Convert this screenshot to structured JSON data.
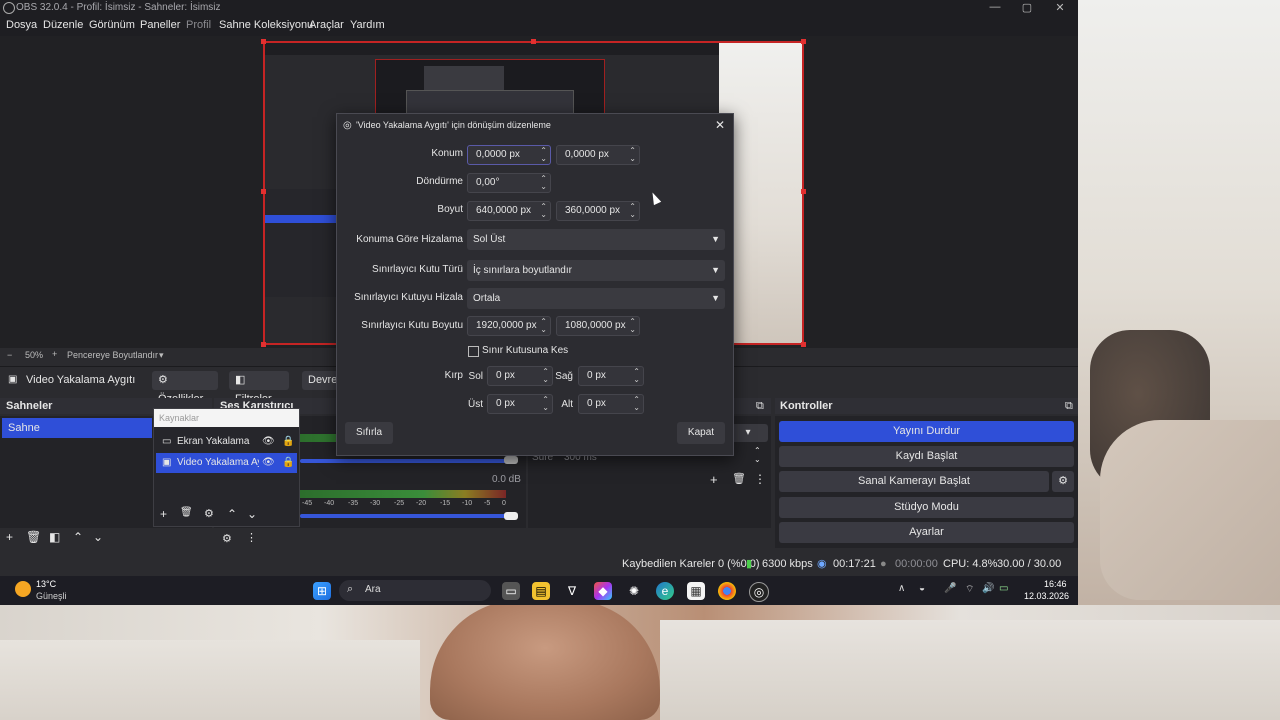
{
  "window": {
    "title": "OBS 32.0.4 - Profil: İsimsiz - Sahneler: İsimsiz",
    "controls": [
      "—",
      "▢",
      "✕"
    ]
  },
  "menu": [
    "Dosya",
    "Düzenle",
    "Görünüm",
    "Paneller",
    "Profil",
    "Sahne Koleksiyonu",
    "Araçlar",
    "Yardım"
  ],
  "zoom": {
    "minus": "−",
    "level": "50%",
    "plus": "+",
    "fit": "Pencereye Boyutlandır"
  },
  "source_bar": {
    "source_name": "Video Yakalama Aygıtı",
    "properties": "Özellikler",
    "filters": "Filtreler",
    "deactivate": "Devre"
  },
  "scenes": {
    "title": "Sahneler",
    "items": [
      "Sahne"
    ]
  },
  "sources_popup": {
    "title": "Kaynaklar",
    "items": [
      "Ekran Yakalama",
      "Video Yakalama Ay"
    ]
  },
  "mixer": {
    "title": "Ses Karıştırıcı",
    "level": "0.0 dB",
    "ticks": [
      "-45",
      "-40",
      "-35",
      "-30",
      "-25",
      "-20",
      "-15",
      "-10",
      "-5",
      "0"
    ]
  },
  "transition": {
    "duration_label": "Süre",
    "duration_value": "300 ms"
  },
  "controls": {
    "title": "Kontroller",
    "buttons": [
      "Yayını Durdur",
      "Kaydı Başlat",
      "Sanal Kamerayı Başlat",
      "Stüdyo Modu",
      "Ayarlar"
    ]
  },
  "status": {
    "dropped": "Kaybedilen Kareler 0 (%0.0)",
    "bitrate": "6300 kbps",
    "stream_time": "00:17:21",
    "rec_time": "00:00:00",
    "cpu": "CPU: 4.8%",
    "fps": "30.00 / 30.00 FPS"
  },
  "dialog": {
    "title": "'Video Yakalama Aygıtı' için dönüşüm düzenleme",
    "position_label": "Konum",
    "position_x": "0,0000 px",
    "position_y": "0,0000 px",
    "rotation_label": "Döndürme",
    "rotation": "0,00°",
    "size_label": "Boyut",
    "size_w": "640,0000 px",
    "size_h": "360,0000 px",
    "align_label": "Konuma Göre Hizalama",
    "align_value": "Sol Üst",
    "bbox_type_label": "Sınırlayıcı Kutu Türü",
    "bbox_type_value": "İç sınırlara boyutlandır",
    "bbox_align_label": "Sınırlayıcı Kutuyu Hizala",
    "bbox_align_value": "Ortala",
    "bbox_size_label": "Sınırlayıcı Kutu Boyutu",
    "bbox_w": "1920,0000 px",
    "bbox_h": "1080,0000 px",
    "crop_to_bounds": "Sınır Kutusuna Kes",
    "crop_label": "Kırp",
    "left_label": "Sol",
    "left": "0 px",
    "right_label": "Sağ",
    "right": "0 px",
    "top_label": "Üst",
    "top": "0 px",
    "bottom_label": "Alt",
    "bottom": "0 px",
    "reset": "Sıfırla",
    "close": "Kapat"
  },
  "taskbar": {
    "weather_temp": "13°C",
    "weather_text": "Güneşli",
    "search": "Ara",
    "time": "16:46",
    "date": "12.03.2026"
  },
  "colors": {
    "accent": "#3d4ad6",
    "selection": "#2f4fd8",
    "bounds": "#c52424"
  }
}
